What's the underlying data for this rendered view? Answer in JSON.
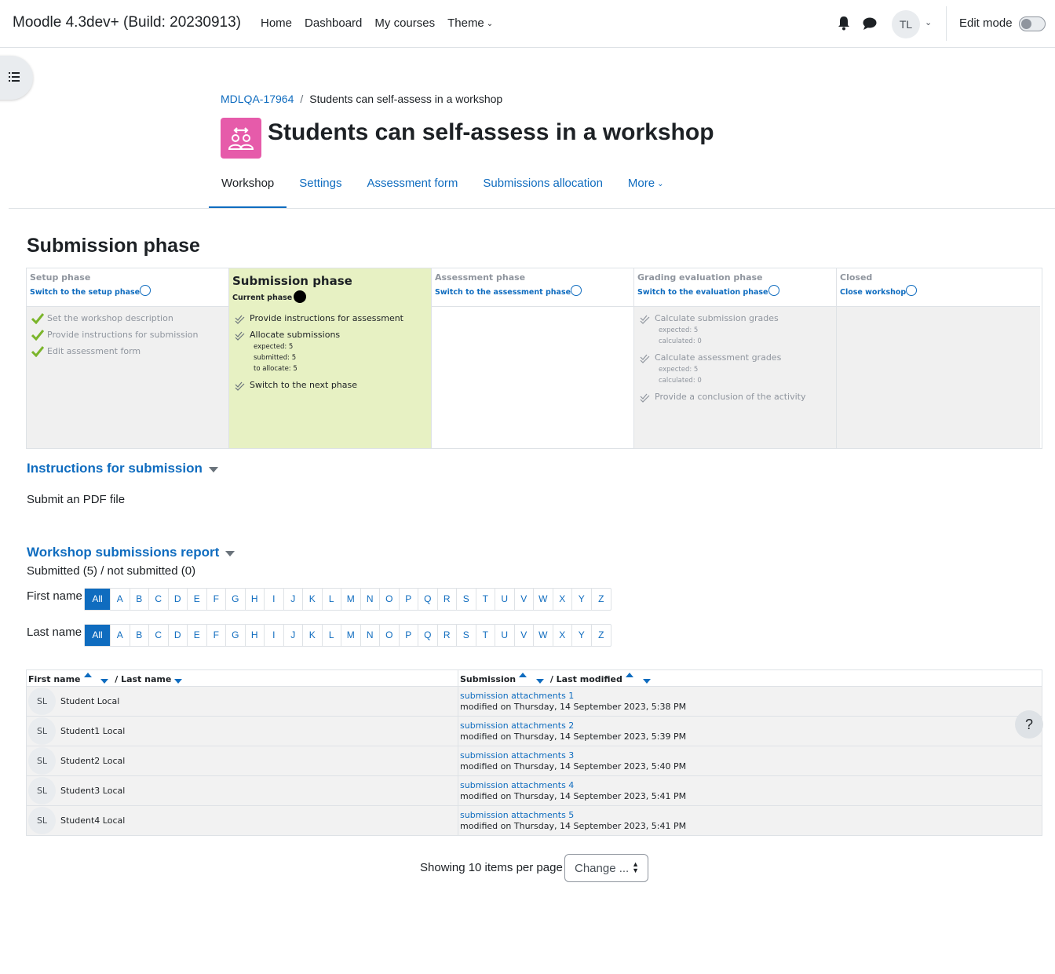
{
  "navbar": {
    "brand": "Moodle 4.3dev+ (Build: 20230913)",
    "links": [
      "Home",
      "Dashboard",
      "My courses",
      "Theme"
    ],
    "user_initials": "TL",
    "edit_mode_label": "Edit mode",
    "edit_mode_on": false
  },
  "breadcrumb": {
    "course": "MDLQA-17964",
    "separator": "/",
    "current": "Students can self-assess in a workshop"
  },
  "page_title": "Students can self-assess in a workshop",
  "tabs": [
    "Workshop",
    "Settings",
    "Assessment form",
    "Submissions allocation",
    "More"
  ],
  "active_tab": "Workshop",
  "phase_heading": "Submission phase",
  "planner": {
    "setup": {
      "name": "Setup phase",
      "action": "Switch to the setup phase",
      "tasks": [
        "Set the workshop description",
        "Provide instructions for submission",
        "Edit assessment form"
      ]
    },
    "submission": {
      "name": "Submission phase",
      "current": "Current phase",
      "tasks": [
        {
          "label": "Provide instructions for assessment"
        },
        {
          "label": "Allocate submissions",
          "details": [
            "expected: 5",
            "submitted: 5",
            "to allocate: 5"
          ]
        },
        {
          "label": "Switch to the next phase"
        }
      ]
    },
    "assessment": {
      "name": "Assessment phase",
      "action": "Switch to the assessment phase"
    },
    "evaluation": {
      "name": "Grading evaluation phase",
      "action": "Switch to the evaluation phase",
      "tasks": [
        {
          "label": "Calculate submission grades",
          "details": [
            "expected: 5",
            "calculated: 0"
          ]
        },
        {
          "label": "Calculate assessment grades",
          "details": [
            "expected: 5",
            "calculated: 0"
          ]
        },
        {
          "label": "Provide a conclusion of the activity"
        }
      ]
    },
    "closed": {
      "name": "Closed",
      "action": "Close workshop"
    }
  },
  "instructions": {
    "title": "Instructions for submission",
    "text": "Submit an PDF file"
  },
  "report": {
    "title": "Workshop submissions report",
    "summary": "Submitted (5) / not submitted (0)",
    "first_name_label": "First name",
    "last_name_label": "Last name",
    "all_label": "All",
    "letters": [
      "A",
      "B",
      "C",
      "D",
      "E",
      "F",
      "G",
      "H",
      "I",
      "J",
      "K",
      "L",
      "M",
      "N",
      "O",
      "P",
      "Q",
      "R",
      "S",
      "T",
      "U",
      "V",
      "W",
      "X",
      "Y",
      "Z"
    ],
    "columns": {
      "first_name": "First name",
      "last_name": "/ Last name",
      "submission": "Submission",
      "last_modified": "/ Last modified"
    },
    "modified_prefix": "modified on",
    "rows": [
      {
        "initials": "SL",
        "name": "Student Local",
        "submission": "submission attachments 1",
        "modified": "Thursday, 14 September 2023, 5:38 PM"
      },
      {
        "initials": "SL",
        "name": "Student1 Local",
        "submission": "submission attachments 2",
        "modified": "Thursday, 14 September 2023, 5:39 PM"
      },
      {
        "initials": "SL",
        "name": "Student2 Local",
        "submission": "submission attachments 3",
        "modified": "Thursday, 14 September 2023, 5:40 PM"
      },
      {
        "initials": "SL",
        "name": "Student3 Local",
        "submission": "submission attachments 4",
        "modified": "Thursday, 14 September 2023, 5:41 PM"
      },
      {
        "initials": "SL",
        "name": "Student4 Local",
        "submission": "submission attachments 5",
        "modified": "Thursday, 14 September 2023, 5:41 PM"
      }
    ]
  },
  "paging": {
    "showing": "Showing 10 items per page",
    "change_label": "Change ..."
  },
  "help_label": "?"
}
